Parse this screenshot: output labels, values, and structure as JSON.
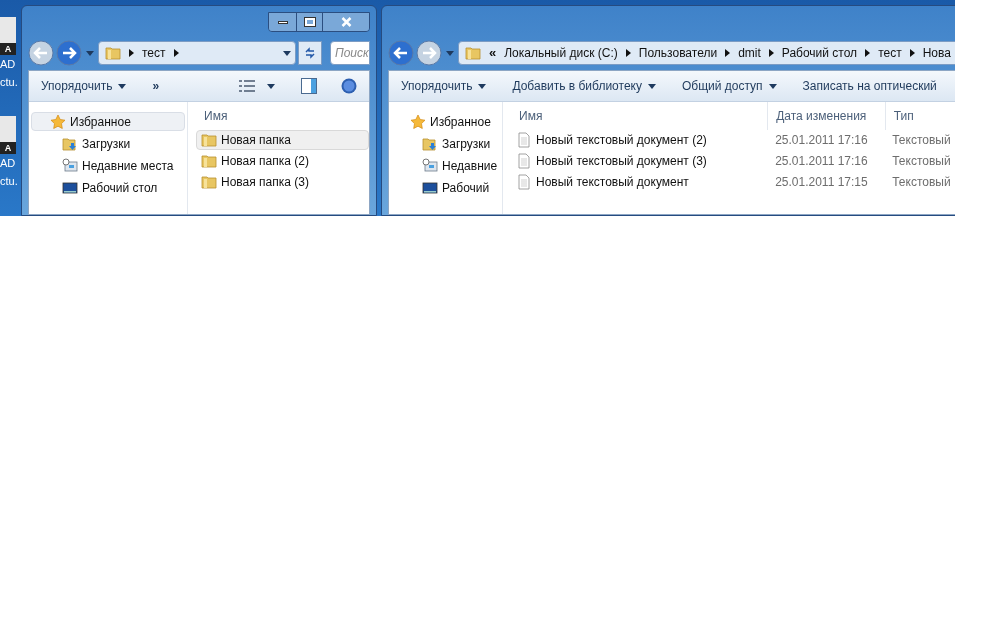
{
  "desktop_icons": [
    {
      "badge": "A",
      "lines": [
        "AD",
        "ctu."
      ]
    },
    {
      "badge": "A",
      "lines": [
        "AD",
        "ctu."
      ]
    }
  ],
  "left_window": {
    "nav": [
      {
        "kind": "back",
        "disabled": true
      },
      {
        "kind": "forward",
        "disabled": false
      }
    ],
    "address": {
      "crumbs": [
        "тест"
      ]
    },
    "search": {
      "placeholder": "Поиск"
    },
    "toolbar": [
      {
        "kind": "menu",
        "label": "Упорядочить"
      },
      {
        "kind": "more",
        "label": "»"
      }
    ],
    "sidebar": [
      {
        "kind": "favorites",
        "label": "Избранное",
        "selected": true
      },
      {
        "kind": "downloads",
        "label": "Загрузки",
        "selected": false
      },
      {
        "kind": "recent",
        "label": "Недавние места",
        "selected": false
      },
      {
        "kind": "desktop",
        "label": "Рабочий стол",
        "selected": false
      }
    ],
    "columns": [
      "Имя"
    ],
    "rows": [
      {
        "kind": "folder",
        "cells": [
          "Новая папка"
        ],
        "selected": true
      },
      {
        "kind": "folder",
        "cells": [
          "Новая папка (2)"
        ],
        "selected": false
      },
      {
        "kind": "folder",
        "cells": [
          "Новая папка (3)"
        ],
        "selected": false
      }
    ]
  },
  "right_window": {
    "nav": [
      {
        "kind": "back",
        "disabled": false
      },
      {
        "kind": "forward",
        "disabled": true
      }
    ],
    "address": {
      "overflow": "«",
      "crumbs": [
        "Локальный диск (C:)",
        "Пользователи",
        "dmit",
        "Рабочий стол",
        "тест",
        "Нова"
      ]
    },
    "toolbar": [
      {
        "kind": "menu",
        "label": "Упорядочить"
      },
      {
        "kind": "menu",
        "label": "Добавить в библиотеку"
      },
      {
        "kind": "menu",
        "label": "Общий доступ"
      },
      {
        "kind": "plain",
        "label": "Записать на оптический"
      }
    ],
    "sidebar": [
      {
        "kind": "favorites",
        "label": "Избранное",
        "selected": false
      },
      {
        "kind": "downloads",
        "label": "Загрузки",
        "selected": false
      },
      {
        "kind": "recent",
        "label": "Недавние",
        "selected": false
      },
      {
        "kind": "desktop",
        "label": "Рабочий",
        "selected": false
      }
    ],
    "columns": [
      "Имя",
      "Дата изменения",
      "Тип"
    ],
    "rows": [
      {
        "kind": "text",
        "cells": [
          "Новый текстовый документ (2)",
          "25.01.2011 17:16",
          "Текстовый"
        ],
        "selected": false
      },
      {
        "kind": "text",
        "cells": [
          "Новый текстовый документ (3)",
          "25.01.2011 17:16",
          "Текстовый"
        ],
        "selected": false
      },
      {
        "kind": "text",
        "cells": [
          "Новый текстовый документ",
          "25.01.2011 17:15",
          "Текстовый"
        ],
        "selected": false
      }
    ]
  }
}
